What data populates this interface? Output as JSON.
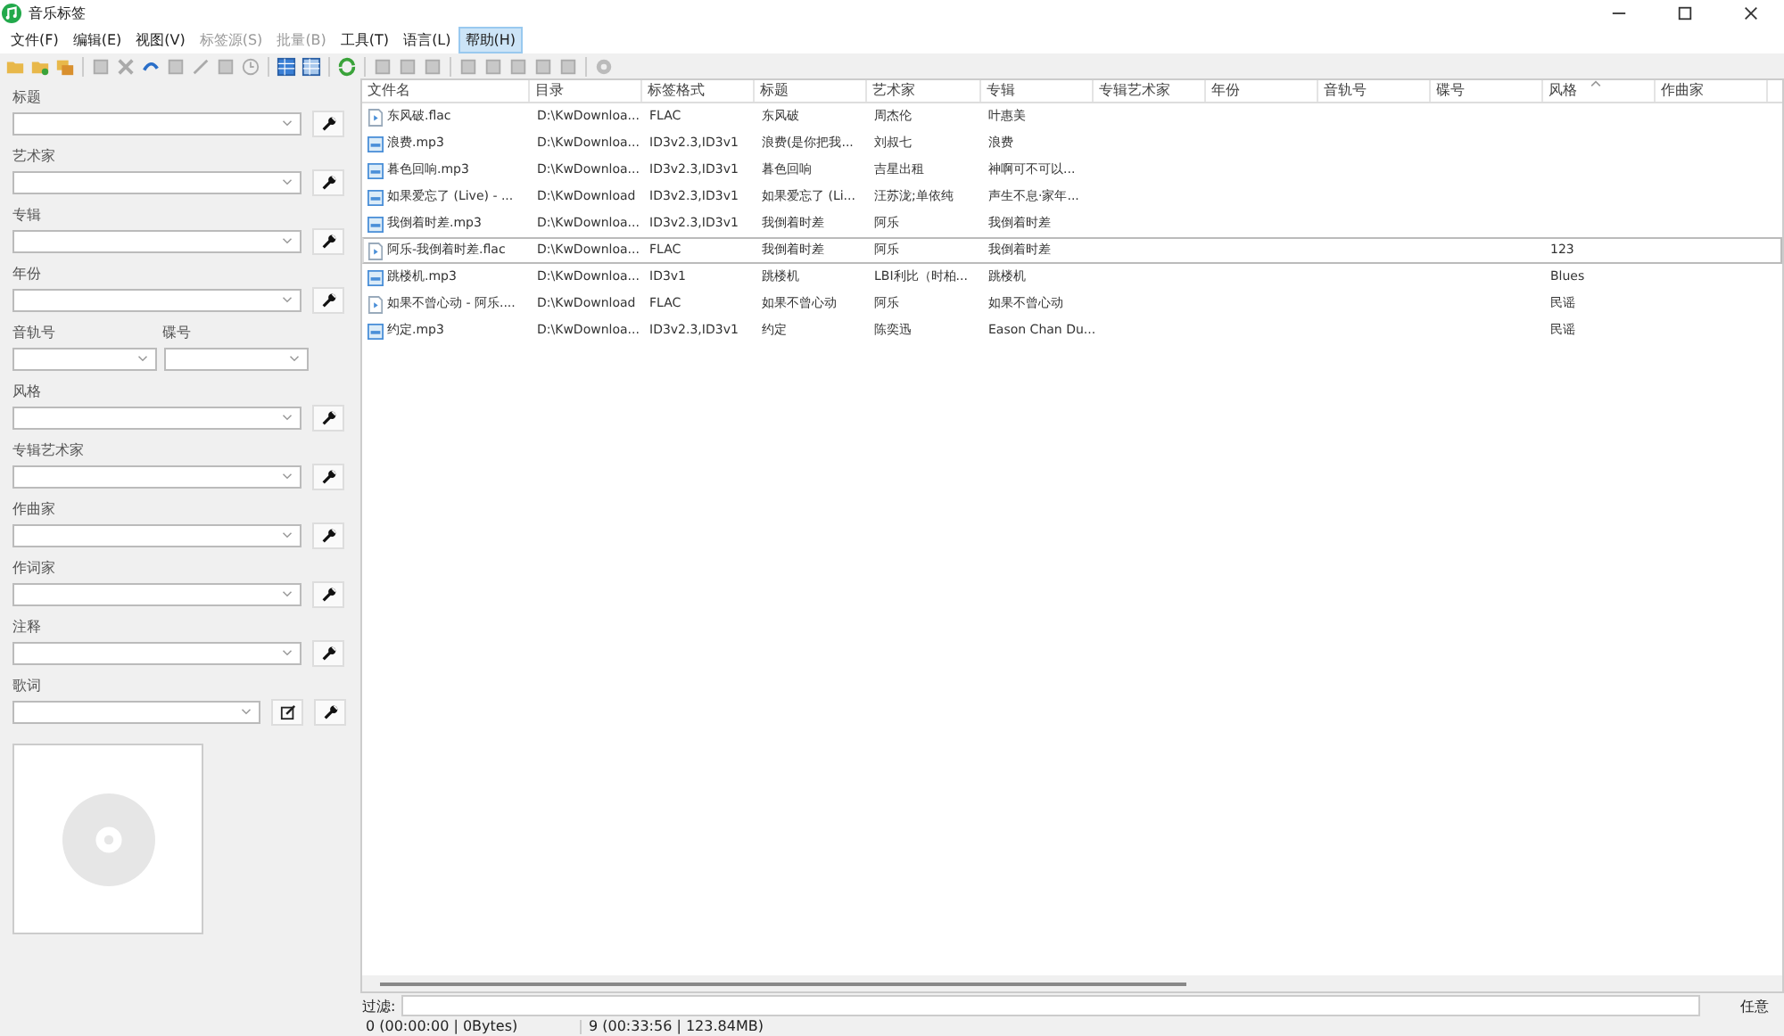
{
  "window": {
    "title": "音乐标签"
  },
  "menu": [
    {
      "label": "文件(F)",
      "disabled": false,
      "selected": false
    },
    {
      "label": "编辑(E)",
      "disabled": false,
      "selected": false
    },
    {
      "label": "视图(V)",
      "disabled": false,
      "selected": false
    },
    {
      "label": "标签源(S)",
      "disabled": true,
      "selected": false
    },
    {
      "label": "批量(B)",
      "disabled": true,
      "selected": false
    },
    {
      "label": "工具(T)",
      "disabled": false,
      "selected": false
    },
    {
      "label": "语言(L)",
      "disabled": false,
      "selected": false
    },
    {
      "label": "帮助(H)",
      "disabled": false,
      "selected": true
    }
  ],
  "fields": [
    {
      "kind": "combo",
      "label": "标题"
    },
    {
      "kind": "combo",
      "label": "艺术家"
    },
    {
      "kind": "combo",
      "label": "专辑"
    },
    {
      "kind": "combo",
      "label": "年份"
    },
    {
      "kind": "pair",
      "label": "音轨号",
      "label_2": "碟号"
    },
    {
      "kind": "combo",
      "label": "风格"
    },
    {
      "kind": "combo",
      "label": "专辑艺术家"
    },
    {
      "kind": "combo",
      "label": "作曲家"
    },
    {
      "kind": "combo",
      "label": "作词家"
    },
    {
      "kind": "combo",
      "label": "注释"
    },
    {
      "kind": "lyrics",
      "label": "歌词"
    }
  ],
  "table": {
    "columns": [
      {
        "label": "文件名",
        "sorted": false
      },
      {
        "label": "目录",
        "sorted": false
      },
      {
        "label": "标签格式",
        "sorted": false
      },
      {
        "label": "标题",
        "sorted": false
      },
      {
        "label": "艺术家",
        "sorted": false
      },
      {
        "label": "专辑",
        "sorted": false
      },
      {
        "label": "专辑艺术家",
        "sorted": false
      },
      {
        "label": "年份",
        "sorted": false
      },
      {
        "label": "音轨号",
        "sorted": false
      },
      {
        "label": "碟号",
        "sorted": false
      },
      {
        "label": "风格",
        "sorted": true
      },
      {
        "label": "作曲家",
        "sorted": false
      }
    ],
    "rows": [
      {
        "kind": "flac",
        "selected": false,
        "file": "东风破.flac",
        "directory": "D:\\KwDownloa...",
        "tag_format": "FLAC",
        "title": "东风破",
        "artist": "周杰伦",
        "album": "叶惠美"
      },
      {
        "kind": "mp3",
        "selected": false,
        "file": "浪费.mp3",
        "directory": "D:\\KwDownloa...",
        "tag_format": "ID3v2.3,ID3v1",
        "title": "浪费(是你把我...",
        "artist": "刘叔七",
        "album": "浪费"
      },
      {
        "kind": "mp3",
        "selected": false,
        "file": "暮色回响.mp3",
        "directory": "D:\\KwDownloa...",
        "tag_format": "ID3v2.3,ID3v1",
        "title": "暮色回响",
        "artist": "吉星出租",
        "album": "神啊可不可以..."
      },
      {
        "kind": "mp3",
        "selected": false,
        "file": "如果爱忘了 (Live) - ...",
        "directory": "D:\\KwDownload",
        "tag_format": "ID3v2.3,ID3v1",
        "title": "如果爱忘了 (Li...",
        "artist": "汪苏泷;单依纯",
        "album": "声生不息·家年..."
      },
      {
        "kind": "mp3",
        "selected": false,
        "file": "我倒着时差.mp3",
        "directory": "D:\\KwDownloa...",
        "tag_format": "ID3v2.3,ID3v1",
        "title": "我倒着时差",
        "artist": "阿乐",
        "album": "我倒着时差"
      },
      {
        "kind": "flac",
        "selected": true,
        "file": "阿乐-我倒着时差.flac",
        "directory": "D:\\KwDownloa...",
        "tag_format": "FLAC",
        "title": "我倒着时差",
        "artist": "阿乐",
        "album": "我倒着时差",
        "genre": "123"
      },
      {
        "kind": "mp3",
        "selected": false,
        "file": "跳楼机.mp3",
        "directory": "D:\\KwDownloa...",
        "tag_format": "ID3v1",
        "title": "跳楼机",
        "artist": "LBI利比（时柏...",
        "album": "跳楼机",
        "genre": "Blues"
      },
      {
        "kind": "flac",
        "selected": false,
        "file": "如果不曾心动 - 阿乐....",
        "directory": "D:\\KwDownload",
        "tag_format": "FLAC",
        "title": "如果不曾心动",
        "artist": "阿乐",
        "album": "如果不曾心动",
        "genre": "民谣"
      },
      {
        "kind": "mp3",
        "selected": false,
        "file": "约定.mp3",
        "directory": "D:\\KwDownloa...",
        "tag_format": "ID3v2.3,ID3v1",
        "title": "约定",
        "artist": "陈奕迅",
        "album": "Eason Chan Du...",
        "genre": "民谣"
      }
    ]
  },
  "filter": {
    "label": "过滤:",
    "mode": "任意"
  },
  "status_bar": [
    "0 (00:00:00 | 0Bytes)",
    "9 (00:33:56 | 123.84MB)"
  ]
}
